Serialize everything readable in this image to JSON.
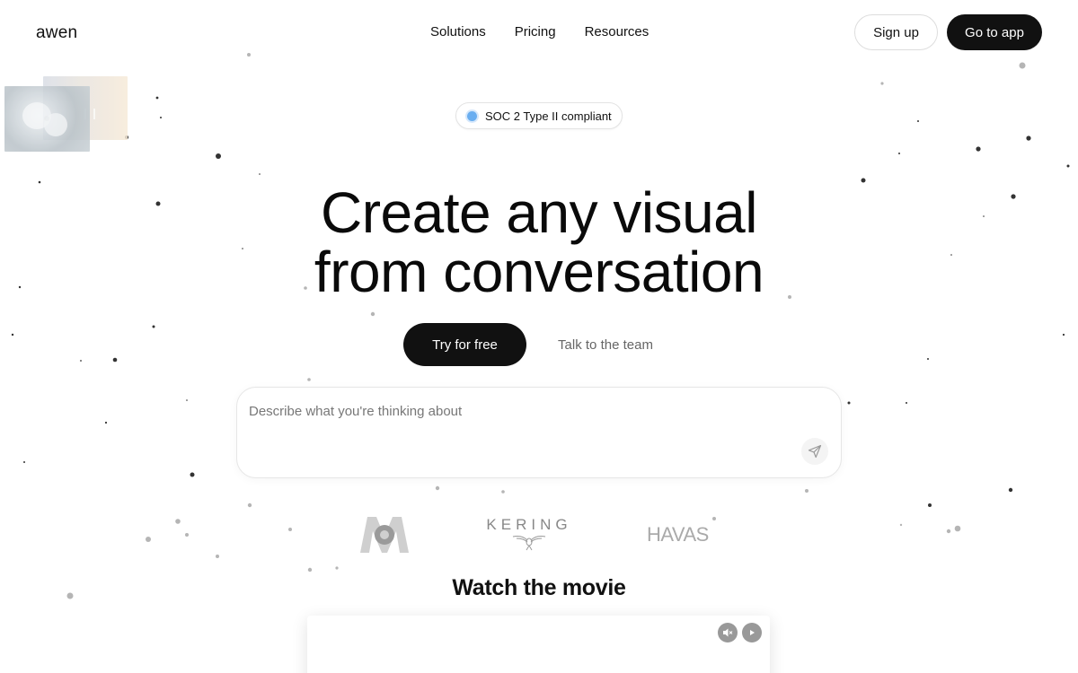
{
  "header": {
    "logo": "awen",
    "nav": [
      "Solutions",
      "Pricing",
      "Resources"
    ],
    "signup_label": "Sign up",
    "goapp_label": "Go to app"
  },
  "badge": {
    "text": "SOC 2 Type II compliant",
    "dot_color": "#6aaef0"
  },
  "hero": {
    "line1": "Create any visual",
    "line2": "from conversation"
  },
  "cta": {
    "primary_label": "Try for free",
    "secondary_label": "Talk to the team"
  },
  "prompt": {
    "placeholder": "Describe what you're thinking about",
    "value": "",
    "send_icon": "send-icon"
  },
  "clients": {
    "m6": "6",
    "kering": "KERING",
    "havas": "HAVAS"
  },
  "movie": {
    "title": "Watch the movie",
    "mute_icon": "volume-mute-icon",
    "play_icon": "play-icon"
  },
  "colors": {
    "primary": "#111111",
    "accent_blue": "#6aaef0",
    "muted_text": "#666666"
  }
}
